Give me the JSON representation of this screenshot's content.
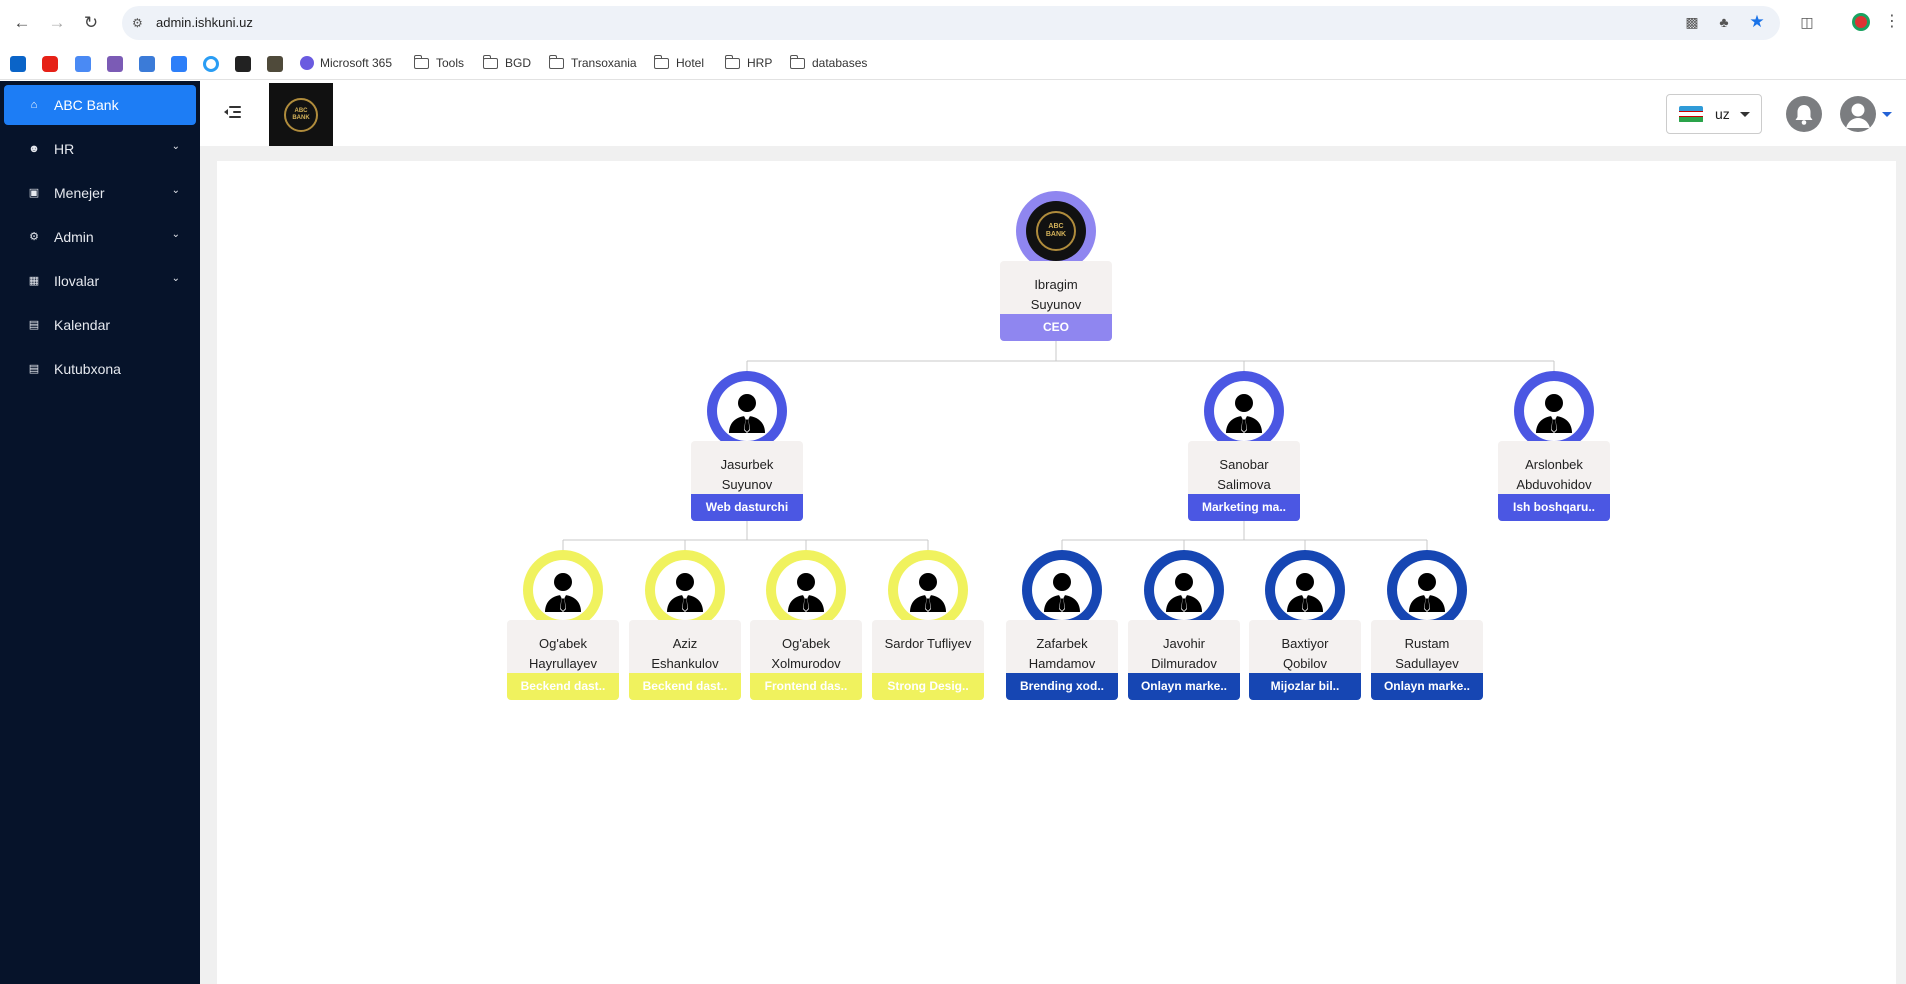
{
  "browser": {
    "url": "admin.ishkuni.uz",
    "bookmarks": [
      {
        "label": "Microsoft 365",
        "type": "link"
      },
      {
        "label": "Tools",
        "type": "folder"
      },
      {
        "label": "BGD",
        "type": "folder"
      },
      {
        "label": "Transoxania",
        "type": "folder"
      },
      {
        "label": "Hotel",
        "type": "folder"
      },
      {
        "label": "HRP",
        "type": "folder"
      },
      {
        "label": "databases",
        "type": "folder"
      }
    ]
  },
  "sidebar": {
    "items": [
      {
        "label": "ABC Bank",
        "icon": "home-icon",
        "active": true
      },
      {
        "label": "HR",
        "icon": "users-icon",
        "expandable": true
      },
      {
        "label": "Menejer",
        "icon": "briefcase-icon",
        "expandable": true
      },
      {
        "label": "Admin",
        "icon": "user-gear-icon",
        "expandable": true
      },
      {
        "label": "Ilovalar",
        "icon": "apps-grid-icon",
        "expandable": true
      },
      {
        "label": "Kalendar",
        "icon": "calendar-icon"
      },
      {
        "label": "Kutubxona",
        "icon": "book-icon"
      }
    ]
  },
  "header": {
    "logo_text": "ABC BANK",
    "language": "uz"
  },
  "org_chart": {
    "ceo": {
      "first": "Ibragim",
      "last": "Suyunov",
      "position": "CEO",
      "color": "#8f86f0"
    },
    "managers": [
      {
        "first": "Jasurbek",
        "last": "Suyunov",
        "position": "Web dasturchi",
        "color": "#4b57e3"
      },
      {
        "first": "Sanobar",
        "last": "Salimova",
        "position": "Marketing ma..",
        "color": "#4b57e3"
      },
      {
        "first": "Arslonbek",
        "last": "Abduvohidov",
        "position": "Ish boshqaru..",
        "color": "#4b57e3"
      }
    ],
    "staff": [
      {
        "first": "Og'abek",
        "last": "Hayrullayev",
        "position": "Beckend dast..",
        "color": "#f0f25e"
      },
      {
        "first": "Aziz",
        "last": "Eshankulov",
        "position": "Beckend dast..",
        "color": "#f0f25e"
      },
      {
        "first": "Og'abek",
        "last": "Xolmurodov",
        "position": "Frontend das..",
        "color": "#f0f25e"
      },
      {
        "first": "Sardor Tufliyev",
        "last": "",
        "position": "Strong Desig..",
        "color": "#f0f25e"
      },
      {
        "first": "Zafarbek",
        "last": "Hamdamov",
        "position": "Brending xod..",
        "color": "#1646b3"
      },
      {
        "first": "Javohir",
        "last": "Dilmuradov",
        "position": "Onlayn marke..",
        "color": "#1646b3"
      },
      {
        "first": "Baxtiyor",
        "last": "Qobilov",
        "position": "Mijozlar bil..",
        "color": "#1646b3"
      },
      {
        "first": "Rustam",
        "last": "Sadullayev",
        "position": "Onlayn marke..",
        "color": "#1646b3"
      }
    ]
  }
}
